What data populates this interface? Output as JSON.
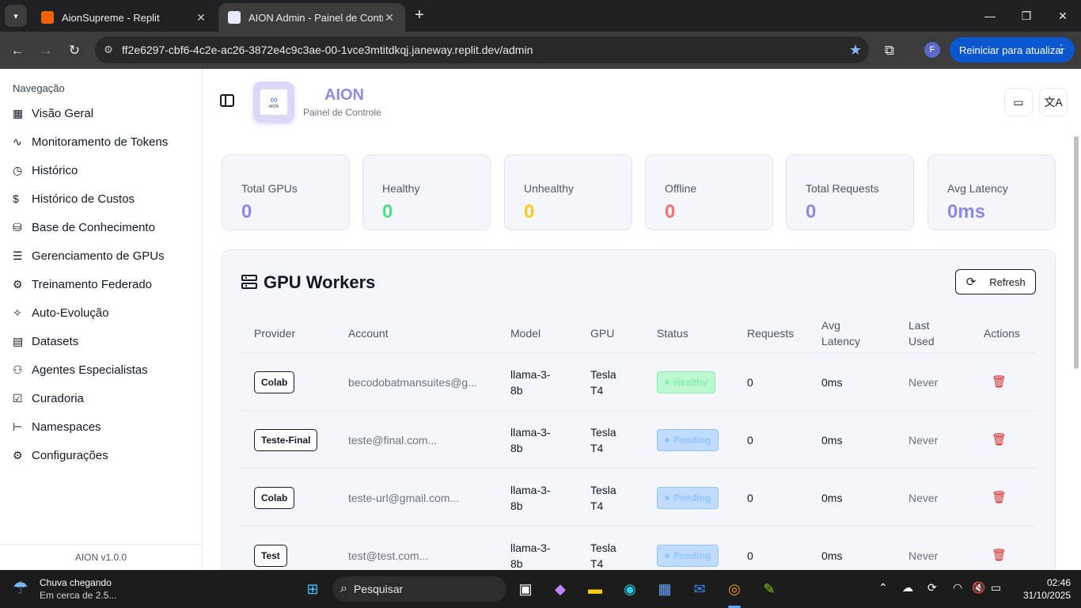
{
  "browser": {
    "tabs": [
      {
        "title": "AionSupreme - Replit",
        "active": false
      },
      {
        "title": "AION Admin - Painel de Controle",
        "active": true
      }
    ],
    "new_tab": "+",
    "url": "ff2e6297-cbf6-4c2e-ac26-3872e4c9c3ae-00-1vce3mtitdkqj.janeway.replit.dev/admin",
    "profile_initial": "F",
    "update_button": "Reiniciar para atualizar"
  },
  "sidebar": {
    "heading": "Navegação",
    "items": [
      {
        "label": "Visão Geral",
        "icon": "grid-icon"
      },
      {
        "label": "Monitoramento de Tokens",
        "icon": "activity-icon"
      },
      {
        "label": "Histórico",
        "icon": "clock-icon"
      },
      {
        "label": "Histórico de Custos",
        "icon": "dollar-icon"
      },
      {
        "label": "Base de Conhecimento",
        "icon": "database-icon"
      },
      {
        "label": "Gerenciamento de GPUs",
        "icon": "server-icon"
      },
      {
        "label": "Treinamento Federado",
        "icon": "network-icon"
      },
      {
        "label": "Auto-Evolução",
        "icon": "sparkles-icon"
      },
      {
        "label": "Datasets",
        "icon": "file-icon"
      },
      {
        "label": "Agentes Especialistas",
        "icon": "users-icon"
      },
      {
        "label": "Curadoria",
        "icon": "clipboard-check-icon"
      },
      {
        "label": "Namespaces",
        "icon": "folder-tree-icon"
      },
      {
        "label": "Configurações",
        "icon": "gear-icon"
      }
    ],
    "version": "AION v1.0.0"
  },
  "header": {
    "brand": "AION",
    "subtitle": "Painel de Controle",
    "logo_text": "AION"
  },
  "stats": [
    {
      "label": "Total GPUs",
      "value": "0",
      "color": "#8b8be6"
    },
    {
      "label": "Healthy",
      "value": "0",
      "color": "#4ade80"
    },
    {
      "label": "Unhealthy",
      "value": "0",
      "color": "#facc15"
    },
    {
      "label": "Offline",
      "value": "0",
      "color": "#f87171"
    },
    {
      "label": "Total Requests",
      "value": "0",
      "color": "#8b8be6"
    },
    {
      "label": "Avg Latency",
      "value": "0ms",
      "color": "#8b8be6"
    }
  ],
  "workers": {
    "title": "GPU Workers",
    "refresh_label": "Refresh",
    "columns": [
      "Provider",
      "Account",
      "Model",
      "GPU",
      "Status",
      "Requests",
      "Avg Latency",
      "Last Used",
      "Actions"
    ],
    "rows": [
      {
        "provider": "Colab",
        "account": "becodobatmansuites@g...",
        "model": "llama-3-8b",
        "gpu": "Tesla T4",
        "status": "Healthy",
        "requests": "0",
        "latency": "0ms",
        "last_used": "Never"
      },
      {
        "provider": "Teste-Final",
        "account": "teste@final.com...",
        "model": "llama-3-8b",
        "gpu": "Tesla T4",
        "status": "Pending",
        "requests": "0",
        "latency": "0ms",
        "last_used": "Never"
      },
      {
        "provider": "Colab",
        "account": "teste-url@gmail.com...",
        "model": "llama-3-8b",
        "gpu": "Tesla T4",
        "status": "Pending",
        "requests": "0",
        "latency": "0ms",
        "last_used": "Never"
      },
      {
        "provider": "Test",
        "account": "test@test.com...",
        "model": "llama-3-8b",
        "gpu": "Tesla T4",
        "status": "Pending",
        "requests": "0",
        "latency": "0ms",
        "last_used": "Never"
      }
    ]
  },
  "taskbar": {
    "weather_title": "Chuva chegando",
    "weather_sub": "Em cerca de 2.5...",
    "search_placeholder": "Pesquisar",
    "time": "02:46",
    "date": "31/10/2025"
  }
}
